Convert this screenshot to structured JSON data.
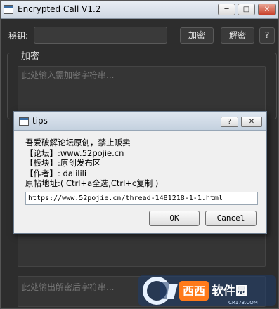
{
  "window": {
    "title": "Encrypted Call V1.2",
    "min": "─",
    "max": "□",
    "close": "✕"
  },
  "toolbar": {
    "key_label": "秘钥:",
    "key_value": "",
    "encrypt_label": "加密",
    "decrypt_label": "解密",
    "help_label": "?"
  },
  "encrypt_group": {
    "title": "加密",
    "placeholder": "此处输入需加密字符串..."
  },
  "decrypt_output": {
    "placeholder": "此处输出解密后字符串..."
  },
  "dialog": {
    "title": "tips",
    "help": "?",
    "close": "✕",
    "lines": [
      "吾爱破解论坛原创，禁止贩卖",
      "【论坛】:www.52pojie.cn",
      "【板块】:原创发布区",
      "【作者】: dalilili",
      "原帖地址:( Ctrl+a全选,Ctrl+c复制 )"
    ],
    "url": "https://www.52pojie.cn/thread-1481218-1-1.html",
    "ok": "OK",
    "cancel": "Cancel"
  },
  "watermark": {
    "text": "西西软件园",
    "sub": "CR173.COM"
  }
}
